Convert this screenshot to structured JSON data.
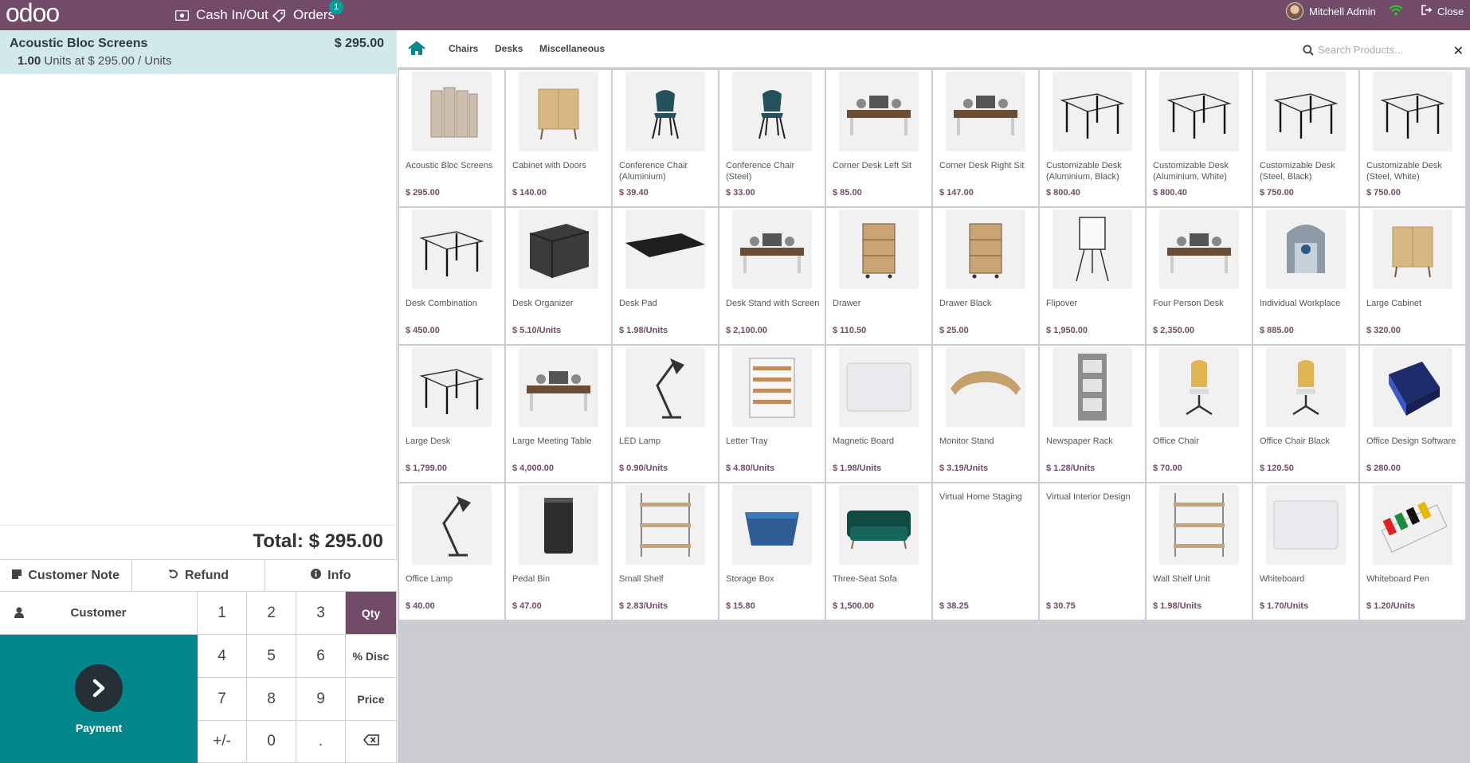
{
  "topbar": {
    "logo": "odoo",
    "cash_label": "Cash In/Out",
    "orders_label": "Orders",
    "orders_count": "1",
    "user_name": "Mitchell Admin",
    "close_label": "Close"
  },
  "order": {
    "line_name": "Acoustic Bloc Screens",
    "line_price": "$ 295.00",
    "line_qty": "1.00",
    "line_unit_text": "Units at $ 295.00 / Units",
    "total": "Total: $ 295.00"
  },
  "controls": {
    "customer_note": "Customer Note",
    "refund": "Refund",
    "info": "Info",
    "customer": "Customer",
    "payment": "Payment"
  },
  "numpad": [
    "1",
    "2",
    "3",
    "Qty",
    "4",
    "5",
    "6",
    "% Disc",
    "7",
    "8",
    "9",
    "Price",
    "+/-",
    "0",
    "."
  ],
  "categories": [
    "Chairs",
    "Desks",
    "Miscellaneous"
  ],
  "search": {
    "placeholder": "Search Products..."
  },
  "products": [
    {
      "name": "Acoustic Bloc Screens",
      "price": "$ 295.00",
      "icon": "screen-icon"
    },
    {
      "name": "Cabinet with Doors",
      "price": "$ 140.00",
      "icon": "cabinet-icon"
    },
    {
      "name": "Conference Chair (Aluminium)",
      "price": "$ 39.40",
      "icon": "chair-icon"
    },
    {
      "name": "Conference Chair (Steel)",
      "price": "$ 33.00",
      "icon": "chair-icon"
    },
    {
      "name": "Corner Desk Left Sit",
      "price": "$ 85.00",
      "icon": "desk-icon"
    },
    {
      "name": "Corner Desk Right Sit",
      "price": "$ 147.00",
      "icon": "desk-icon"
    },
    {
      "name": "Customizable Desk (Aluminium, Black)",
      "price": "$ 800.40",
      "icon": "table-icon"
    },
    {
      "name": "Customizable Desk (Aluminium, White)",
      "price": "$ 800.40",
      "icon": "table-icon"
    },
    {
      "name": "Customizable Desk (Steel, Black)",
      "price": "$ 750.00",
      "icon": "table-icon"
    },
    {
      "name": "Customizable Desk (Steel, White)",
      "price": "$ 750.00",
      "icon": "table-icon"
    },
    {
      "name": "Desk Combination",
      "price": "$ 450.00",
      "icon": "table-icon"
    },
    {
      "name": "Desk Organizer",
      "price": "$ 5.10/Units",
      "icon": "organizer-icon"
    },
    {
      "name": "Desk Pad",
      "price": "$ 1.98/Units",
      "icon": "pad-icon"
    },
    {
      "name": "Desk Stand with Screen",
      "price": "$ 2,100.00",
      "icon": "desk-icon"
    },
    {
      "name": "Drawer",
      "price": "$ 110.50",
      "icon": "drawer-icon"
    },
    {
      "name": "Drawer Black",
      "price": "$ 25.00",
      "icon": "drawer-icon"
    },
    {
      "name": "Flipover",
      "price": "$ 1,950.00",
      "icon": "flipchart-icon"
    },
    {
      "name": "Four Person Desk",
      "price": "$ 2,350.00",
      "icon": "desk-icon"
    },
    {
      "name": "Individual Workplace",
      "price": "$ 885.00",
      "icon": "booth-icon"
    },
    {
      "name": "Large Cabinet",
      "price": "$ 320.00",
      "icon": "cabinet-icon"
    },
    {
      "name": "Large Desk",
      "price": "$ 1,799.00",
      "icon": "table-icon"
    },
    {
      "name": "Large Meeting Table",
      "price": "$ 4,000.00",
      "icon": "desk-icon"
    },
    {
      "name": "LED Lamp",
      "price": "$ 0.90/Units",
      "icon": "lamp-icon"
    },
    {
      "name": "Letter Tray",
      "price": "$ 4.80/Units",
      "icon": "tray-icon"
    },
    {
      "name": "Magnetic Board",
      "price": "$ 1.98/Units",
      "icon": "board-icon"
    },
    {
      "name": "Monitor Stand",
      "price": "$ 3.19/Units",
      "icon": "stand-icon"
    },
    {
      "name": "Newspaper Rack",
      "price": "$ 1.28/Units",
      "icon": "rack-icon"
    },
    {
      "name": "Office Chair",
      "price": "$ 70.00",
      "icon": "office-chair-icon"
    },
    {
      "name": "Office Chair Black",
      "price": "$ 120.50",
      "icon": "office-chair-icon"
    },
    {
      "name": "Office Design Software",
      "price": "$ 280.00",
      "icon": "software-box-icon"
    },
    {
      "name": "Office Lamp",
      "price": "$ 40.00",
      "icon": "lamp-icon"
    },
    {
      "name": "Pedal Bin",
      "price": "$ 47.00",
      "icon": "bin-icon"
    },
    {
      "name": "Small Shelf",
      "price": "$ 2.83/Units",
      "icon": "shelf-icon"
    },
    {
      "name": "Storage Box",
      "price": "$ 15.80",
      "icon": "box-icon"
    },
    {
      "name": "Three-Seat Sofa",
      "price": "$ 1,500.00",
      "icon": "sofa-icon"
    },
    {
      "name": "Virtual Home Staging",
      "price": "$ 38.25",
      "icon": ""
    },
    {
      "name": "Virtual Interior Design",
      "price": "$ 30.75",
      "icon": ""
    },
    {
      "name": "Wall Shelf Unit",
      "price": "$ 1.98/Units",
      "icon": "shelf-icon"
    },
    {
      "name": "Whiteboard",
      "price": "$ 1.70/Units",
      "icon": "board-icon"
    },
    {
      "name": "Whiteboard Pen",
      "price": "$ 1.20/Units",
      "icon": "pen-icon"
    }
  ],
  "colors": {
    "brand": "#714b67",
    "payment": "#01878c",
    "orderline_bg": "#d2e9ec",
    "accent": "#00a09d"
  }
}
